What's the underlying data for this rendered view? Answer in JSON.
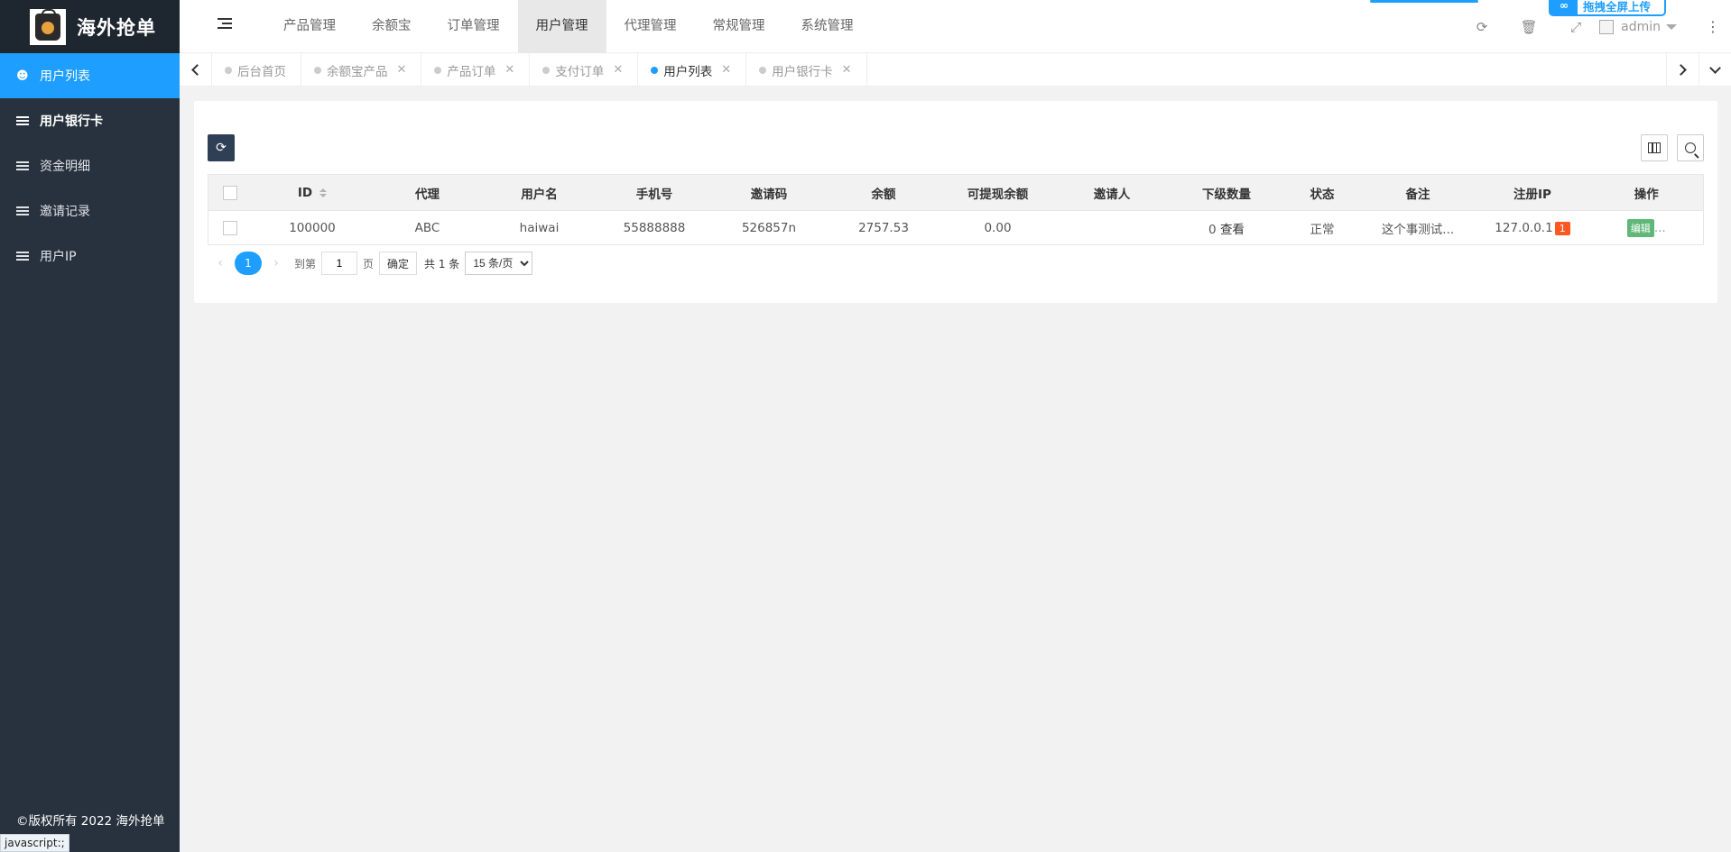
{
  "sidebar": {
    "logo_text": "海外抢单",
    "items": [
      {
        "label": "用户列表",
        "icon": "users-icon"
      },
      {
        "label": "用户银行卡",
        "icon": "list-icon"
      },
      {
        "label": "资金明细",
        "icon": "list-icon"
      },
      {
        "label": "邀请记录",
        "icon": "list-icon"
      },
      {
        "label": "用户IP",
        "icon": "list-icon"
      }
    ],
    "copyright": "©版权所有 2022 海外抢单"
  },
  "status_bar": {
    "url": "javascript:;"
  },
  "header": {
    "nav": [
      "产品管理",
      "余额宝",
      "订单管理",
      "用户管理",
      "代理管理",
      "常规管理",
      "系统管理"
    ],
    "active_nav": "用户管理",
    "user": "admin",
    "upload_label": "拖拽全屏上传"
  },
  "tabs": [
    {
      "label": "后台首页",
      "closable": false
    },
    {
      "label": "余额宝产品",
      "closable": true
    },
    {
      "label": "产品订单",
      "closable": true
    },
    {
      "label": "支付订单",
      "closable": true
    },
    {
      "label": "用户列表",
      "closable": true,
      "active": true
    },
    {
      "label": "用户银行卡",
      "closable": true
    }
  ],
  "table": {
    "headers": [
      "ID",
      "代理",
      "用户名",
      "手机号",
      "邀请码",
      "余额",
      "可提现余额",
      "邀请人",
      "下级数量",
      "状态",
      "备注",
      "注册IP",
      "操作"
    ],
    "rows": [
      {
        "id": "100000",
        "agent": "ABC",
        "username": "haiwai",
        "phone": "55888888",
        "invite_code": "526857n",
        "balance": "2757.53",
        "withdrawable": "0.00",
        "inviter": "",
        "sub_count": "0",
        "sub_view": "查看",
        "status": "正常",
        "remark": "这个事测试...",
        "reg_ip": "127.0.0.1",
        "ip_badge": "1",
        "edit_label": "编辑",
        "more": "..."
      }
    ]
  },
  "pager": {
    "current": "1",
    "goto_label": "到第",
    "page_label": "页",
    "goto_value": "1",
    "confirm": "确定",
    "total": "共 1 条",
    "page_size": "15 条/页"
  },
  "colors": {
    "accent": "#1e9fff",
    "sidebar": "#28323e",
    "edit": "#5fb878",
    "badge": "#ff5722"
  }
}
